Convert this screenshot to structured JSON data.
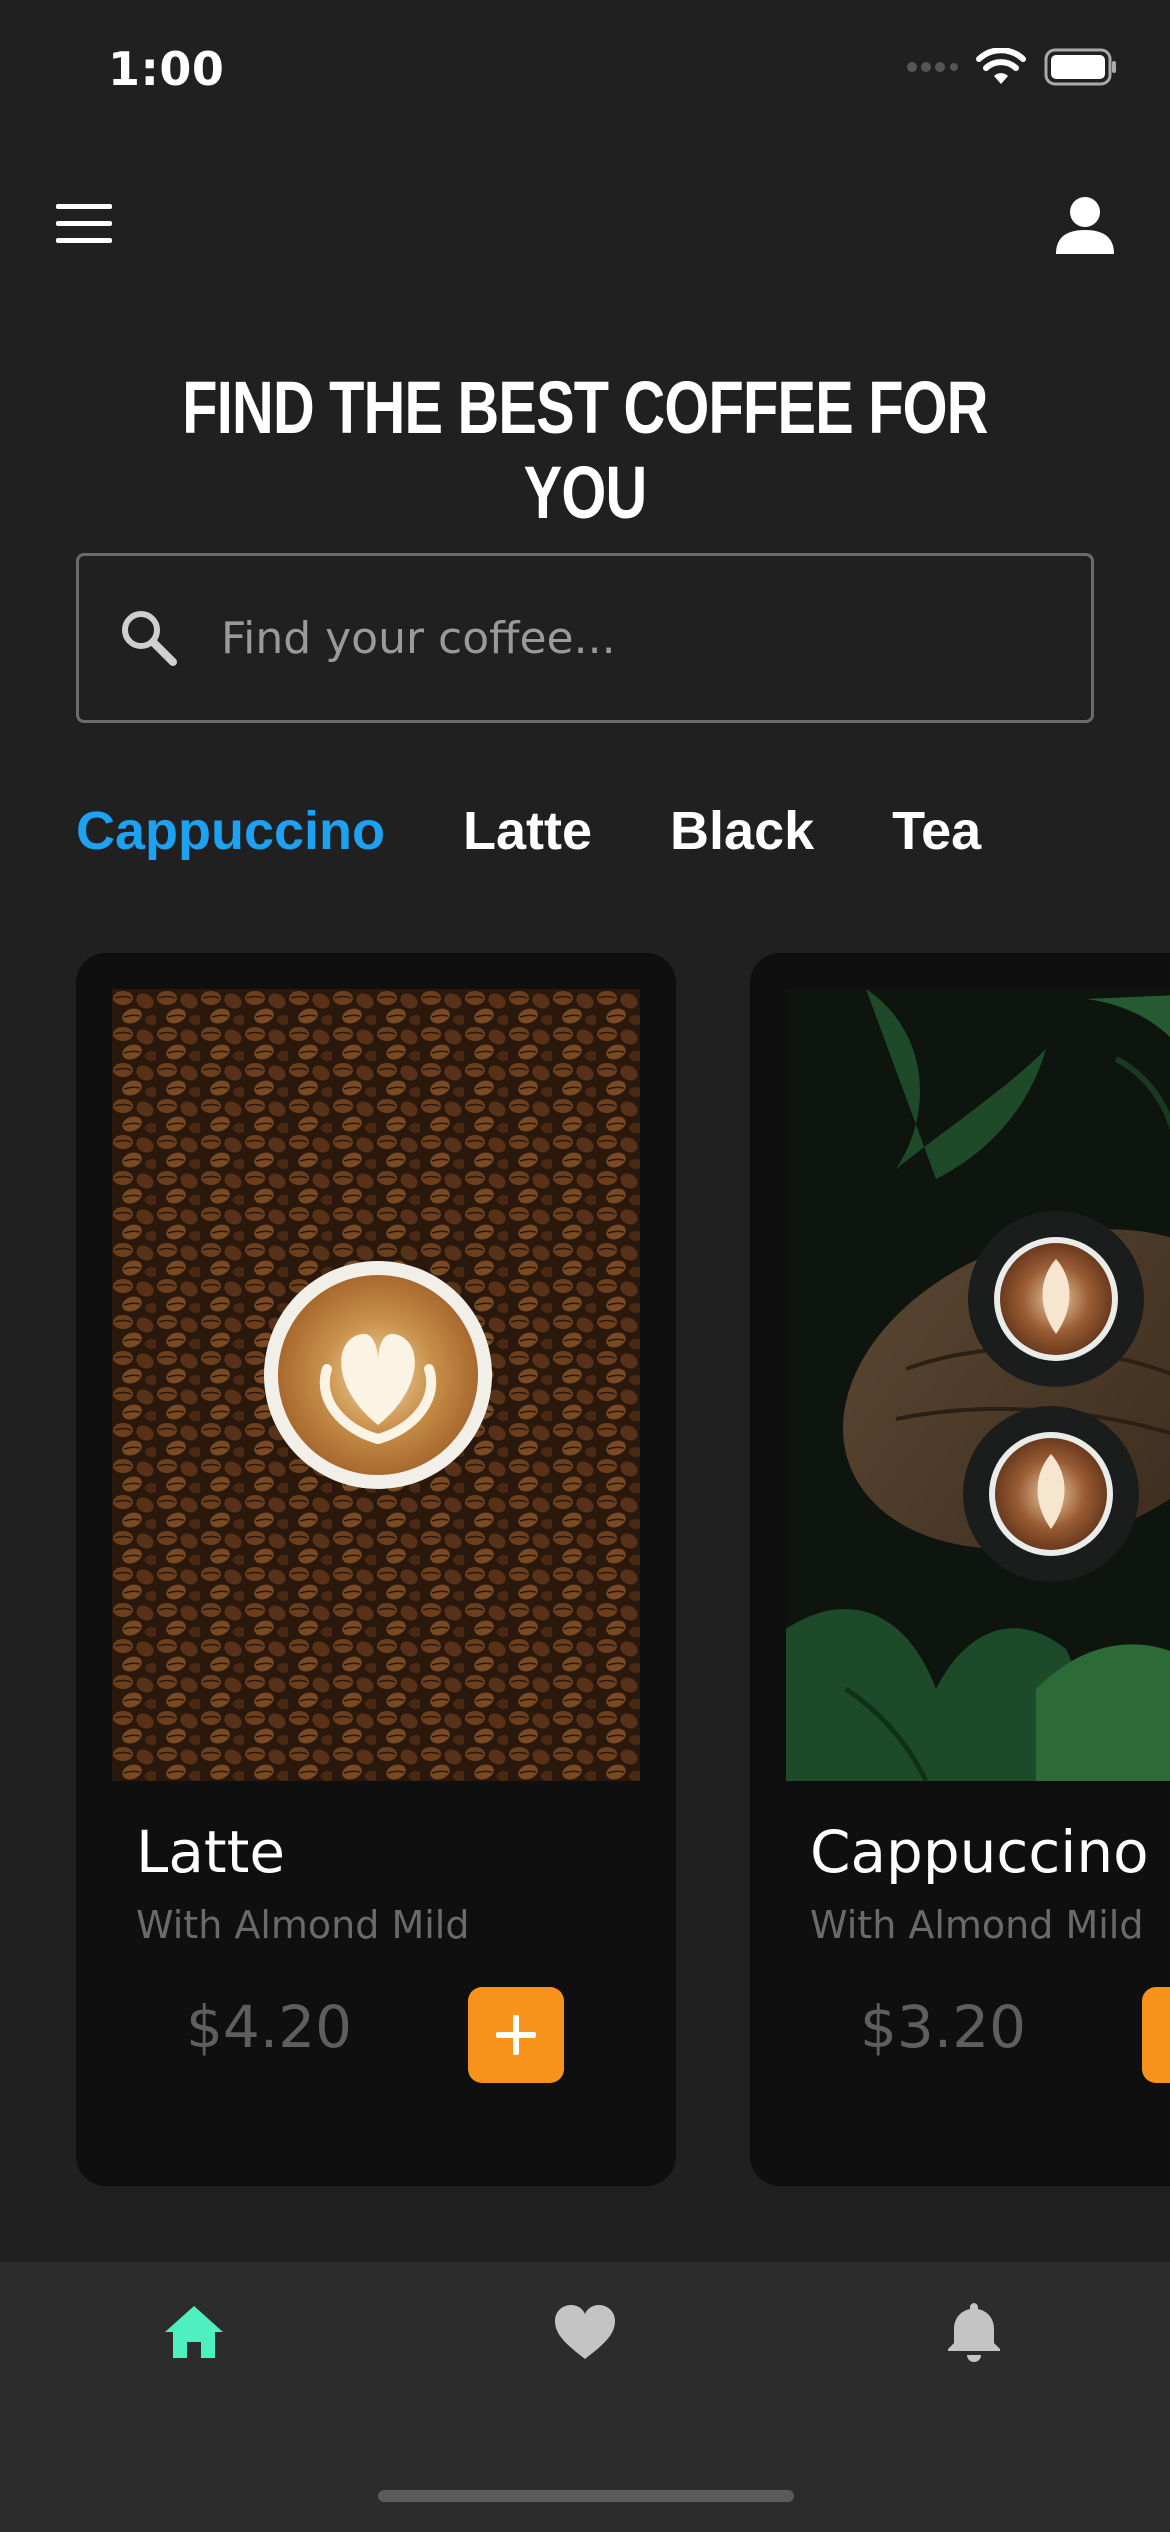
{
  "status_bar": {
    "time": "1:00",
    "icons": [
      "signal-icon",
      "wifi-icon",
      "battery-icon"
    ]
  },
  "header": {
    "menu_icon": "hamburger-menu-icon",
    "profile_icon": "user-icon"
  },
  "headline": "FIND THE BEST COFFEE FOR YOU",
  "search": {
    "placeholder": "Find your coffee...",
    "value": ""
  },
  "categories": [
    {
      "label": "Cappuccino",
      "active": true
    },
    {
      "label": "Latte",
      "active": false
    },
    {
      "label": "Black",
      "active": false
    },
    {
      "label": "Tea",
      "active": false
    }
  ],
  "products": [
    {
      "name": "Latte",
      "subtitle": "With Almond Mild",
      "price": "$4.20"
    },
    {
      "name": "Cappuccino",
      "subtitle": "With Almond Mild",
      "price": "$3.20"
    }
  ],
  "bottom_nav": [
    {
      "icon": "home-icon",
      "active": true
    },
    {
      "icon": "heart-icon",
      "active": false
    },
    {
      "icon": "bell-icon",
      "active": false
    }
  ],
  "colors": {
    "background": "#202020",
    "card": "#0f0f0f",
    "accent_blue": "#1da1f2",
    "accent_orange": "#f7931a",
    "active_nav": "#4ef0c0",
    "inactive_nav": "#c4c4c4"
  }
}
